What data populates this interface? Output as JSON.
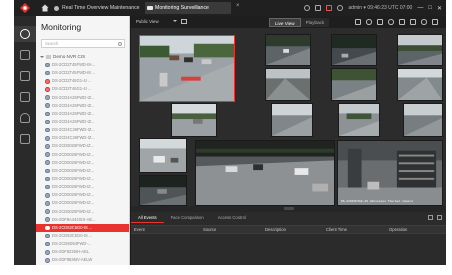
{
  "app": {
    "tabs": [
      {
        "label": "Real Time Overview Maintenance",
        "active": false
      },
      {
        "label": "Monitoring Surveillance",
        "active": true
      }
    ],
    "user_status": "admin ▾  09:46:23 UTC 07:00",
    "window_controls": [
      "—",
      "□",
      "✕"
    ]
  },
  "rail": {
    "items": [
      "monitoring-icon",
      "playback-icon",
      "map-icon",
      "event-icon",
      "person-icon",
      "device-icon"
    ]
  },
  "panel": {
    "title": "Monitoring",
    "search_placeholder": "Search",
    "root_label": "Demo NVR CIS",
    "cameras": [
      {
        "label": "DS-2CD2T45FWD-I8-...",
        "state": "normal"
      },
      {
        "label": "DS-2CD2T45FWD-I8 ...",
        "state": "normal"
      },
      {
        "label": "DS-2CD2T46G1-4I ...",
        "state": "red"
      },
      {
        "label": "DS-2CD2T46G1-4I ...",
        "state": "red"
      },
      {
        "label": "DS-2CD4A26FWD-IZ...",
        "state": "normal"
      },
      {
        "label": "DS-2CD4A26FWD-IZ...",
        "state": "normal"
      },
      {
        "label": "DS-2CD4A26FWD-IZ...",
        "state": "normal"
      },
      {
        "label": "DS-2CD4A26FWD-IZ...",
        "state": "normal"
      },
      {
        "label": "DS-2CD4C26FWD-IZ...",
        "state": "normal"
      },
      {
        "label": "DS-2CD4C26FWD-IZ...",
        "state": "normal"
      },
      {
        "label": "DS-2CD6026FWD-IZ...",
        "state": "normal"
      },
      {
        "label": "DS-2CD6026FWD-IZ...",
        "state": "normal"
      },
      {
        "label": "DS-2CD6026FWD-IZ...",
        "state": "normal"
      },
      {
        "label": "DS-2CD6026FWD-IZ...",
        "state": "normal"
      },
      {
        "label": "DS-2CD6026FWD-IZ...",
        "state": "normal"
      },
      {
        "label": "DS-2CD6026FWD-IZ...",
        "state": "normal"
      },
      {
        "label": "DS-2CD6026FWD-IZ...",
        "state": "normal"
      },
      {
        "label": "DS-2CD6026FWD-IZ...",
        "state": "normal"
      },
      {
        "label": "DS-2CD6026FWD-IZ...",
        "state": "normal"
      },
      {
        "label": "DS-2DF8A442IXS-AE...",
        "state": "normal"
      },
      {
        "label": "DS-2CD63C5G0-IS ...",
        "state": "selected"
      },
      {
        "label": "DS-2CD63C5G0-IS ...",
        "state": "normal"
      },
      {
        "label": "DS-2CD6D54FWD-...",
        "state": "normal"
      },
      {
        "label": "DS-2DF8225IH-AEL",
        "state": "normal"
      },
      {
        "label": "DS-2DF8836IV-AELW",
        "state": "normal"
      }
    ]
  },
  "toolbar": {
    "view_label": "Public View",
    "mode_tabs": [
      {
        "label": "Live View",
        "active": true
      },
      {
        "label": "Playback",
        "active": false
      }
    ],
    "icons": [
      "snapshot-icon",
      "record-icon",
      "grid-icon",
      "fisheye-icon",
      "window-icon",
      "layout-icon",
      "settings-icon",
      "fullscreen-icon"
    ]
  },
  "video_overlay": {
    "osd_text": "DS-2CD63C5G0-IS  Hikvision Thermal Camera"
  },
  "events": {
    "tabs": [
      {
        "label": "All Events",
        "active": true
      },
      {
        "label": "Face Comparison",
        "active": false
      },
      {
        "label": "Access Control",
        "active": false
      }
    ],
    "columns": [
      "Event",
      "Source",
      "Description",
      "Client Time",
      "Operation"
    ]
  },
  "colors": {
    "accent": "#e8332f",
    "dark_bg": "#1b1b1b",
    "panel_bg": "#f5f5f5"
  }
}
